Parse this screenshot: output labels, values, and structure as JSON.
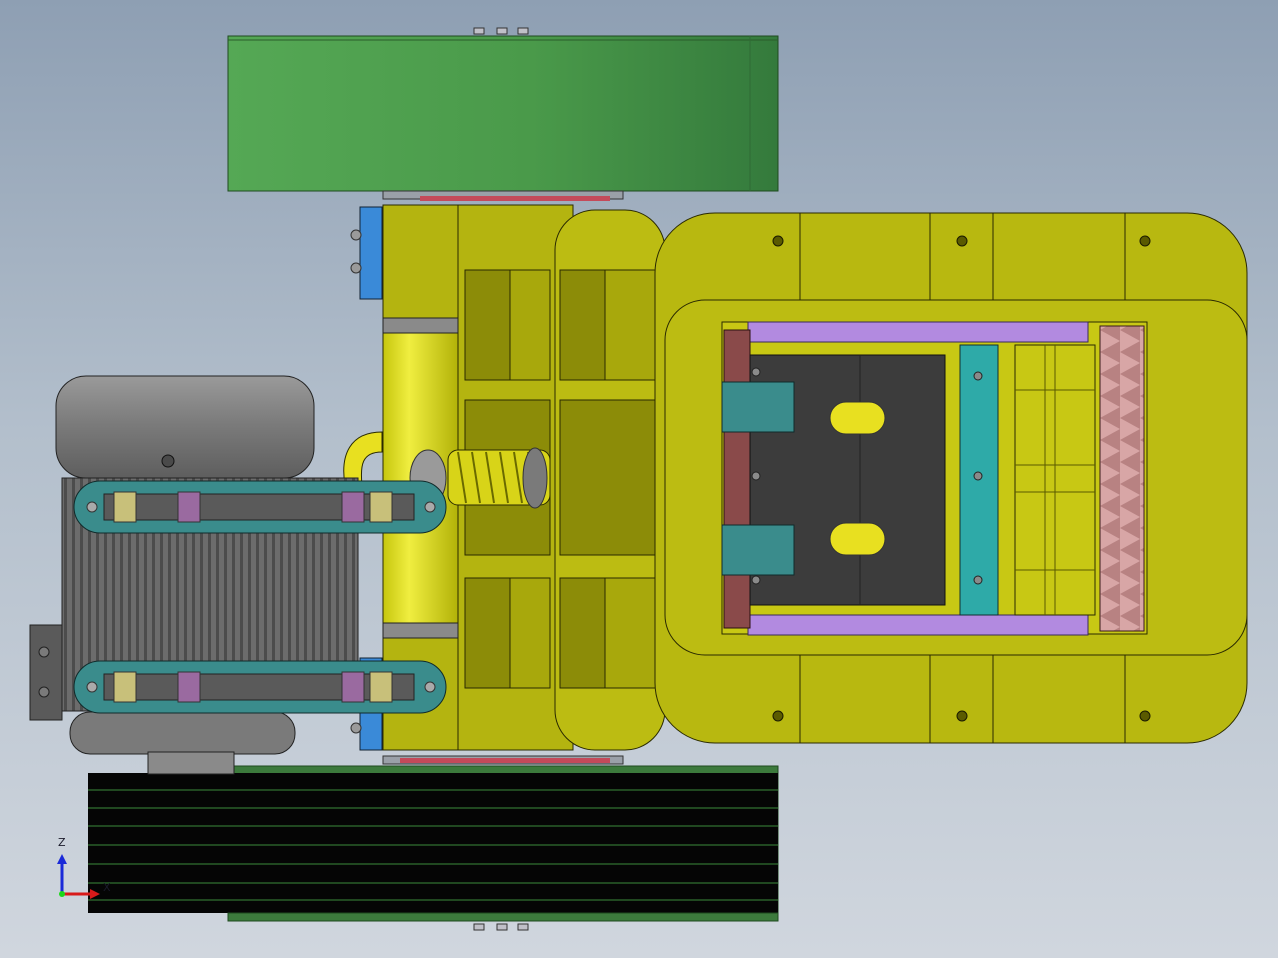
{
  "window": {
    "title": ""
  },
  "scene": {
    "background": {
      "top": "#8e9fb3",
      "bottom": "#d0d6de"
    },
    "colors": {
      "flywheel_green": "#4e9b4e",
      "frame_olive": "#b8b810",
      "frame_olive_dark": "#8c8c08",
      "frame_yellow": "#d2d21e",
      "motor_gray": "#6a6a6a",
      "motor_cap": "#8a8a8a",
      "chamber_dark": "#3c3c3c",
      "liner_purple": "#b28ae0",
      "jaw_maroon": "#8a4a4a",
      "tooth_pink": "#c89090",
      "bracket_teal": "#3a8c8c",
      "plate_cyan": "#2eaaa8",
      "spring_yellow": "#e8e020",
      "blue_block": "#3a8ad8",
      "belt_black": "#050505",
      "belt_line_green": "#3a8a3a"
    },
    "icons": [
      "axis-triad-icon"
    ]
  },
  "view_triad": {
    "z_label": "Z",
    "x_label": "X"
  }
}
